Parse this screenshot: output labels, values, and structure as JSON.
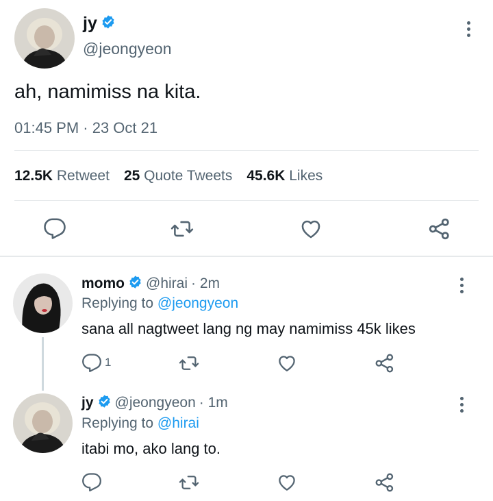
{
  "main_tweet": {
    "display_name": "jy",
    "handle": "@jeongyeon",
    "text": "ah, namimiss na kita.",
    "timestamp": "01:45 PM · 23 Oct 21",
    "stats": {
      "retweets_count": "12.5K",
      "retweets_label": "Retweet",
      "quotes_count": "25",
      "quotes_label": "Quote Tweets",
      "likes_count": "45.6K",
      "likes_label": "Likes"
    }
  },
  "replies": [
    {
      "display_name": "momo",
      "handle": "@hirai",
      "time": "· 2m",
      "replying_prefix": "Replying to",
      "replying_to": "@jeongyeon",
      "text": "sana all nagtweet lang ng may namimiss 45k likes",
      "reply_count": "1"
    },
    {
      "display_name": "jy",
      "handle": "@jeongyeon",
      "time": "· 1m",
      "replying_prefix": "Replying to",
      "replying_to": "@hirai",
      "text": "itabi mo, ako lang to.",
      "reply_count": ""
    }
  ],
  "colors": {
    "accent": "#1d9bf0",
    "text": "#0f1419",
    "secondary": "#536471",
    "divider": "#e6e9eb"
  }
}
